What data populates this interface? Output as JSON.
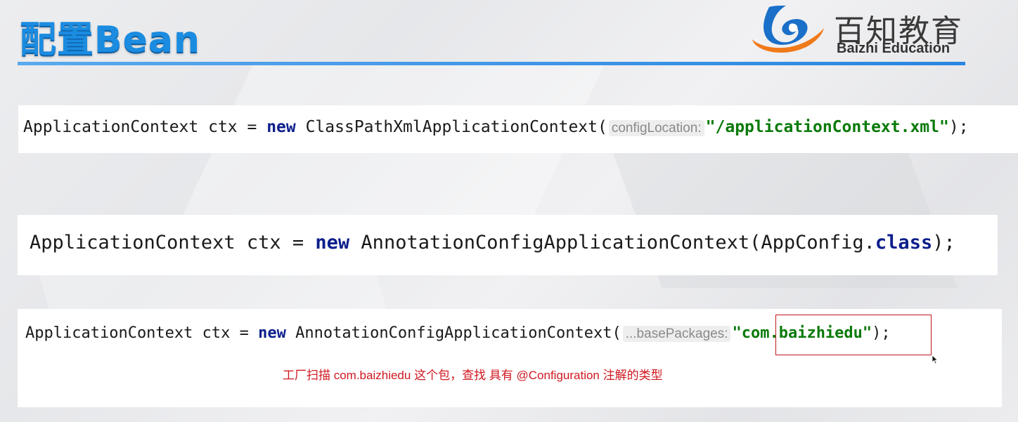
{
  "slide": {
    "title": "配置Bean"
  },
  "brand": {
    "name_cn": "百知教育",
    "name_en": "Baizhi Education"
  },
  "code1": {
    "decl": "ApplicationContext ctx = ",
    "kw_new": "new",
    "ctor": " ClassPathXmlApplicationContext(",
    "hint": "configLocation:",
    "arg": "\"/applicationContext.xml\"",
    "close": ");"
  },
  "code2": {
    "decl": "ApplicationContext ctx = ",
    "kw_new": "new",
    "ctor": " AnnotationConfigApplicationContext(AppConfig.",
    "kw_class": "class",
    "close": ");"
  },
  "code3": {
    "decl": "ApplicationContext ctx = ",
    "kw_new": "new",
    "ctor": " AnnotationConfigApplicationContext(",
    "hint": "...basePackages:",
    "arg": "\"com.baizhiedu\"",
    "close": ");"
  },
  "annotation": {
    "note": "工厂扫描 com.baizhiedu 这个包，查找 具有 @Configuration 注解的类型"
  },
  "colors": {
    "title": "#1b8ce0",
    "rule": "#2a86e0",
    "keyword": "#0d1f8c",
    "string": "#0a7a0a",
    "annotation": "#d01820"
  }
}
